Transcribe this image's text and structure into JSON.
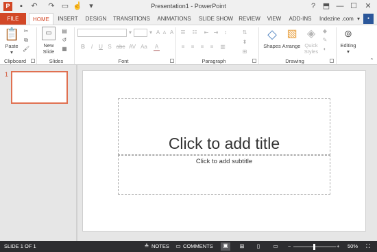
{
  "window": {
    "title": "Presentation1 - PowerPoint",
    "app_icon": "P"
  },
  "quick_access": [
    {
      "name": "save-icon",
      "glyph": "▪"
    },
    {
      "name": "undo-icon",
      "glyph": "↶"
    },
    {
      "name": "redo-icon",
      "glyph": "↷"
    },
    {
      "name": "start-from-beginning-icon",
      "glyph": "▭"
    },
    {
      "name": "touch-mode-icon",
      "glyph": "☝"
    },
    {
      "name": "customize-qat-icon",
      "glyph": "▾"
    }
  ],
  "window_controls": {
    "help": "?",
    "ribbon_options": "⬒",
    "minimize": "—",
    "maximize": "☐",
    "close": "✕"
  },
  "tabs": [
    "FILE",
    "HOME",
    "INSERT",
    "DESIGN",
    "TRANSITIONS",
    "ANIMATIONS",
    "SLIDE SHOW",
    "REVIEW",
    "VIEW",
    "ADD-INS"
  ],
  "active_tab": "HOME",
  "account": {
    "name": "Indezine .com",
    "caret": "▾"
  },
  "ribbon": {
    "clipboard": {
      "label": "Clipboard",
      "paste": "Paste"
    },
    "slides": {
      "label": "Slides",
      "new_slide": "New Slide"
    },
    "font": {
      "label": "Font",
      "bold": "B",
      "italic": "I",
      "underline": "U",
      "strike": "S",
      "shadow": "abc",
      "spacing": "AV",
      "case": "Aa",
      "color": "A",
      "grow": "A",
      "shrink": "A",
      "clear": "A"
    },
    "paragraph": {
      "label": "Paragraph"
    },
    "drawing": {
      "label": "Drawing",
      "shapes": "Shapes",
      "arrange": "Arrange",
      "quick_styles": "Quick Styles"
    },
    "editing": {
      "label": "Editing"
    }
  },
  "thumbnails": [
    {
      "number": "1"
    }
  ],
  "slide": {
    "title_placeholder": "Click to add title",
    "subtitle_placeholder": "Click to add subtitle"
  },
  "status": {
    "slide_info": "SLIDE 1 OF 1",
    "notes": "NOTES",
    "comments": "COMMENTS",
    "zoom_out": "−",
    "zoom_in": "+",
    "zoom": "50%",
    "zoom_level": 0.5
  },
  "colors": {
    "accent": "#d24726",
    "status_bar": "#2d2d30"
  }
}
